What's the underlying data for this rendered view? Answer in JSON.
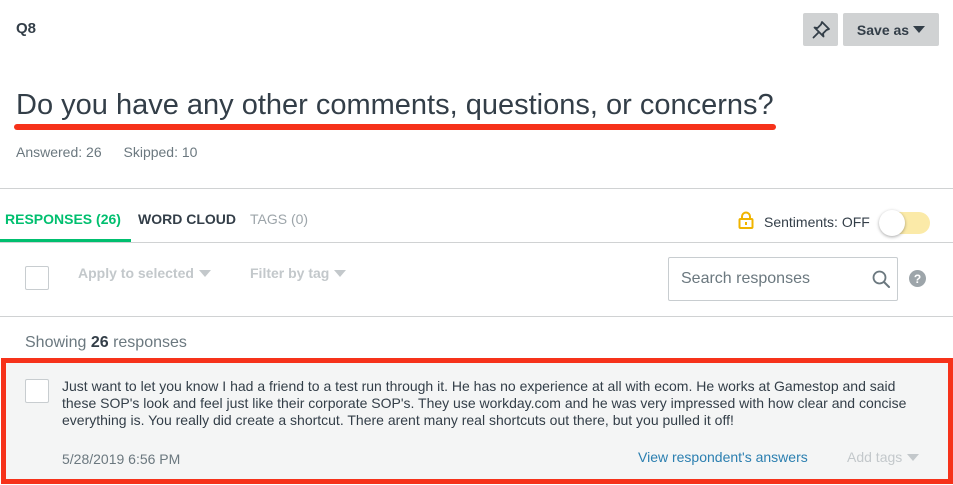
{
  "question": {
    "number": "Q8",
    "title": "Do you have any other comments, questions, or concerns?",
    "answered": "Answered: 26",
    "skipped": "Skipped: 10"
  },
  "toolbar": {
    "save_as_label": "Save as",
    "pin_icon": "pin-icon"
  },
  "tabs": [
    {
      "label": "RESPONSES (26)",
      "active": true
    },
    {
      "label": "WORD CLOUD",
      "active": false
    },
    {
      "label": "TAGS (0)",
      "active": false
    }
  ],
  "sentiments": {
    "label": "Sentiments: OFF",
    "enabled": false,
    "lock_icon": "lock-icon"
  },
  "actions": {
    "apply_to_selected": "Apply to selected",
    "filter_by_tag": "Filter by tag"
  },
  "search": {
    "placeholder": "Search responses",
    "value": ""
  },
  "showing": {
    "prefix": "Showing",
    "count": "26",
    "suffix": "responses"
  },
  "responses": [
    {
      "text": "Just want to let you know I had a friend to a test run through it. He has no experience at all with ecom. He works at Gamestop and said these SOP's look and feel just like their corporate SOP's. They use workday.com and he was very impressed with how clear and concise everything is. You really did create a shortcut. There arent many real shortcuts out there, but you pulled it off!",
      "date": "5/28/2019 6:56 PM",
      "view_link": "View respondent's answers",
      "add_tags": "Add tags"
    }
  ],
  "colors": {
    "accent_green": "#00bf6f",
    "highlight_red": "#f6321a",
    "link_blue": "#2b7fb0",
    "text_dark": "#333e48"
  }
}
